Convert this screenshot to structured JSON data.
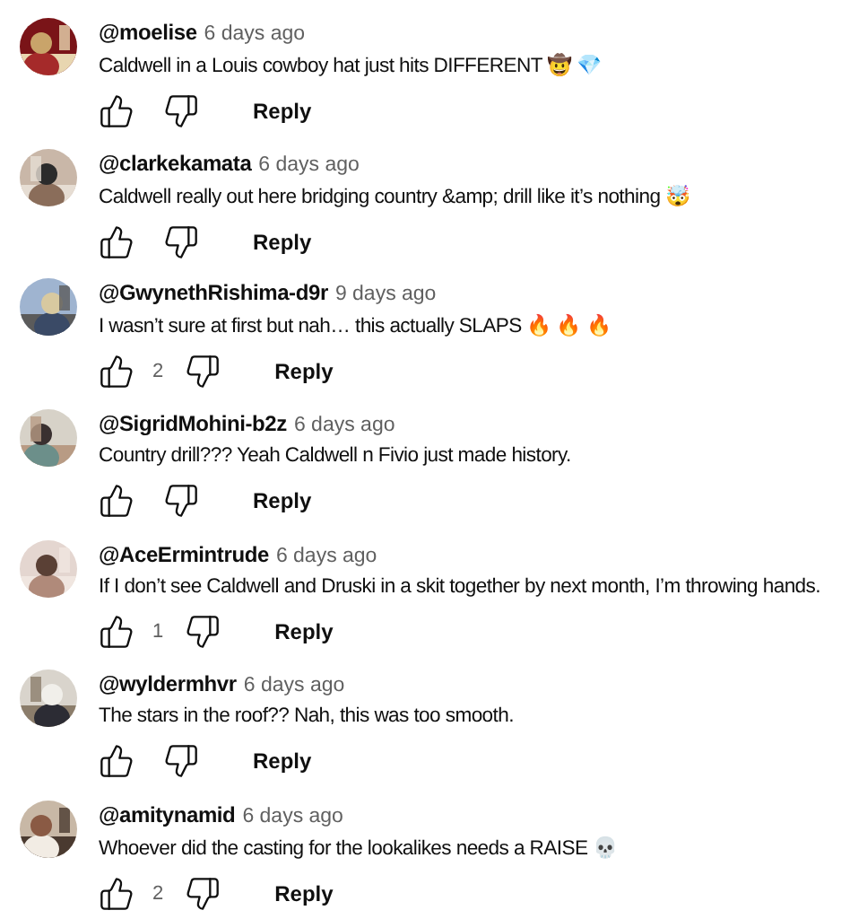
{
  "comments": [
    {
      "author": "@moelise",
      "time": "6 days ago",
      "text": "Caldwell in a Louis cowboy hat just hits DIFFERENT 🤠 💎",
      "reply": "Reply"
    },
    {
      "author": "@clarkekamata",
      "time": "6 days ago",
      "text": "Caldwell really out here bridging country &amp; drill like it’s nothing 🤯",
      "reply": "Reply"
    },
    {
      "author": "@GwynethRishima-d9r",
      "time": "9 days ago",
      "text": "I wasn’t sure at first but nah… this actually SLAPS 🔥 🔥 🔥",
      "likes": "2",
      "reply": "Reply"
    },
    {
      "author": "@SigridMohini-b2z",
      "time": "6 days ago",
      "text": "Country drill??? Yeah Caldwell n Fivio just made history.",
      "reply": "Reply"
    },
    {
      "author": "@AceErmintrude",
      "time": "6 days ago",
      "text": "If I don’t see Caldwell and Druski in a skit together by next month, I’m throwing hands.",
      "likes": "1",
      "reply": "Reply"
    },
    {
      "author": "@wyldermhvr",
      "time": "6 days ago",
      "text": "The stars in the roof?? Nah, this was too smooth.",
      "reply": "Reply"
    },
    {
      "author": "@amitynamid",
      "time": "6 days ago",
      "text": "Whoever did the casting for the lookalikes needs a RAISE 💀",
      "likes": "2",
      "reply": "Reply"
    }
  ]
}
